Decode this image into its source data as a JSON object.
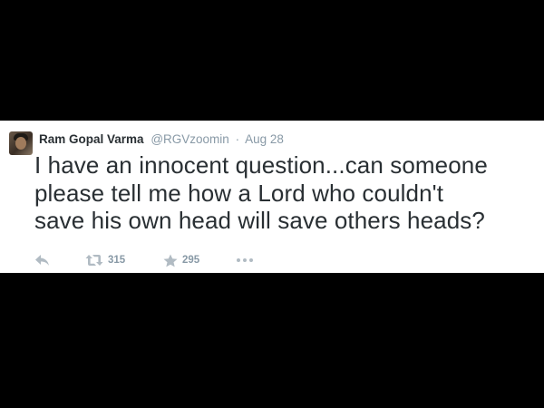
{
  "tweet": {
    "author": {
      "display_name": "Ram Gopal Varma",
      "handle": "@RGVzoomin"
    },
    "separator": "·",
    "timestamp": "Aug 28",
    "text_lines": [
      "I have an innocent question...can someone",
      "please tell me how a Lord who couldn't",
      "save his own head will save others heads?"
    ],
    "actions": {
      "reply_icon": "reply-icon",
      "retweet_icon": "retweet-icon",
      "retweet_count": "315",
      "favorite_icon": "star-icon",
      "favorite_count": "295",
      "more_icon": "more-dots-icon"
    }
  },
  "colors": {
    "background": "#000000",
    "card": "#ffffff",
    "text": "#292f33",
    "muted": "#8899a6",
    "icon": "#b1bbc3"
  }
}
